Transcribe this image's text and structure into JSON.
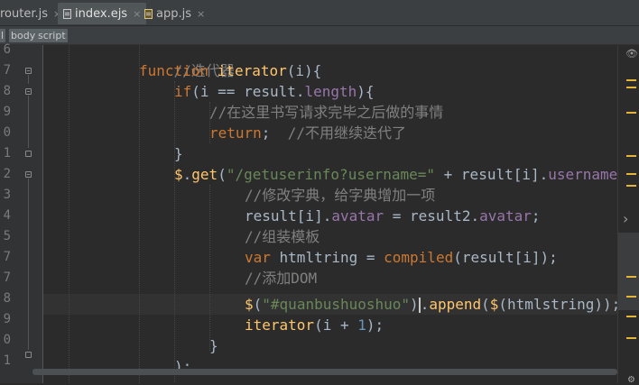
{
  "tabs": [
    {
      "label": "router.js",
      "close": "×",
      "icon": "js-file-icon",
      "active": false
    },
    {
      "label": "index.ejs",
      "close": "×",
      "icon": "ejs-file-icon",
      "active": true
    },
    {
      "label": "app.js",
      "close": "×",
      "icon": "js-file-icon",
      "active": false
    }
  ],
  "breadcrumb": {
    "first": "l",
    "second": "body",
    "third": "script"
  },
  "line_numbers": [
    "6",
    "7",
    "8",
    "9",
    "0",
    "1",
    "2",
    "3",
    "4",
    "5",
    "7",
    "7",
    "8",
    "9",
    "0",
    "1"
  ],
  "code": {
    "l0": {
      "cmt": "//迭代器"
    },
    "l1": {
      "kw": "function",
      "fn": "iterator",
      "rest": "(i){"
    },
    "l2": {
      "kw": "if",
      "a": "(i == ",
      "b": "result",
      "c": ".",
      "prop": "length",
      "d": "){"
    },
    "l3": {
      "cmt": "//在这里书写请求完毕之后做的事情"
    },
    "l4": {
      "kw": "return",
      "a": ";  ",
      "cmt": "//不用继续迭代了"
    },
    "l5": {
      "a": "}"
    },
    "l6": {
      "dollar": "$",
      "a": ".",
      "fn": "get",
      "b": "(",
      "str": "\"/getuserinfo?username=\"",
      "c": " + ",
      "d": "result",
      "e": "[i].",
      "prop": "username"
    },
    "l7": {
      "cmt": "//修改字典，给字典增加一项"
    },
    "l8": {
      "a": "result",
      "b": "[i].",
      "prop": "avatar",
      "c": " = ",
      "d": "result2",
      "e": ".",
      "prop2": "avatar",
      "f": ";"
    },
    "l9": {
      "cmt": "//组装模板"
    },
    "l10": {
      "kw": "var",
      "a": " htmltring = ",
      "fn": "compiled",
      "b": "(",
      "c": "result",
      "d": "[i]);"
    },
    "l11": {
      "cmt": "//添加DOM"
    },
    "l12": {
      "dollar": "$",
      "a": "(",
      "str": "\"#quanbushuoshuo\"",
      "b": ")",
      "c": ".",
      "fn": "append",
      "d": "(",
      "dollar2": "$",
      "e": "(htmlstring));"
    },
    "l13": {
      "fn": "iterator",
      "a": "(i + ",
      "num": "1",
      "b": ");"
    },
    "l14": {
      "a": "}"
    },
    "l15": {
      "a": ");"
    }
  },
  "colors": {
    "background": "#2b2b2b",
    "keyword": "#cc7832",
    "function": "#ffc66d",
    "string": "#6a8759",
    "comment": "#808080",
    "property": "#9876aa",
    "number": "#6897bb",
    "marker": "#e5b23a"
  },
  "right_icons": {
    "eye": "👁",
    "chevron": "›",
    "gear": "⚙"
  }
}
